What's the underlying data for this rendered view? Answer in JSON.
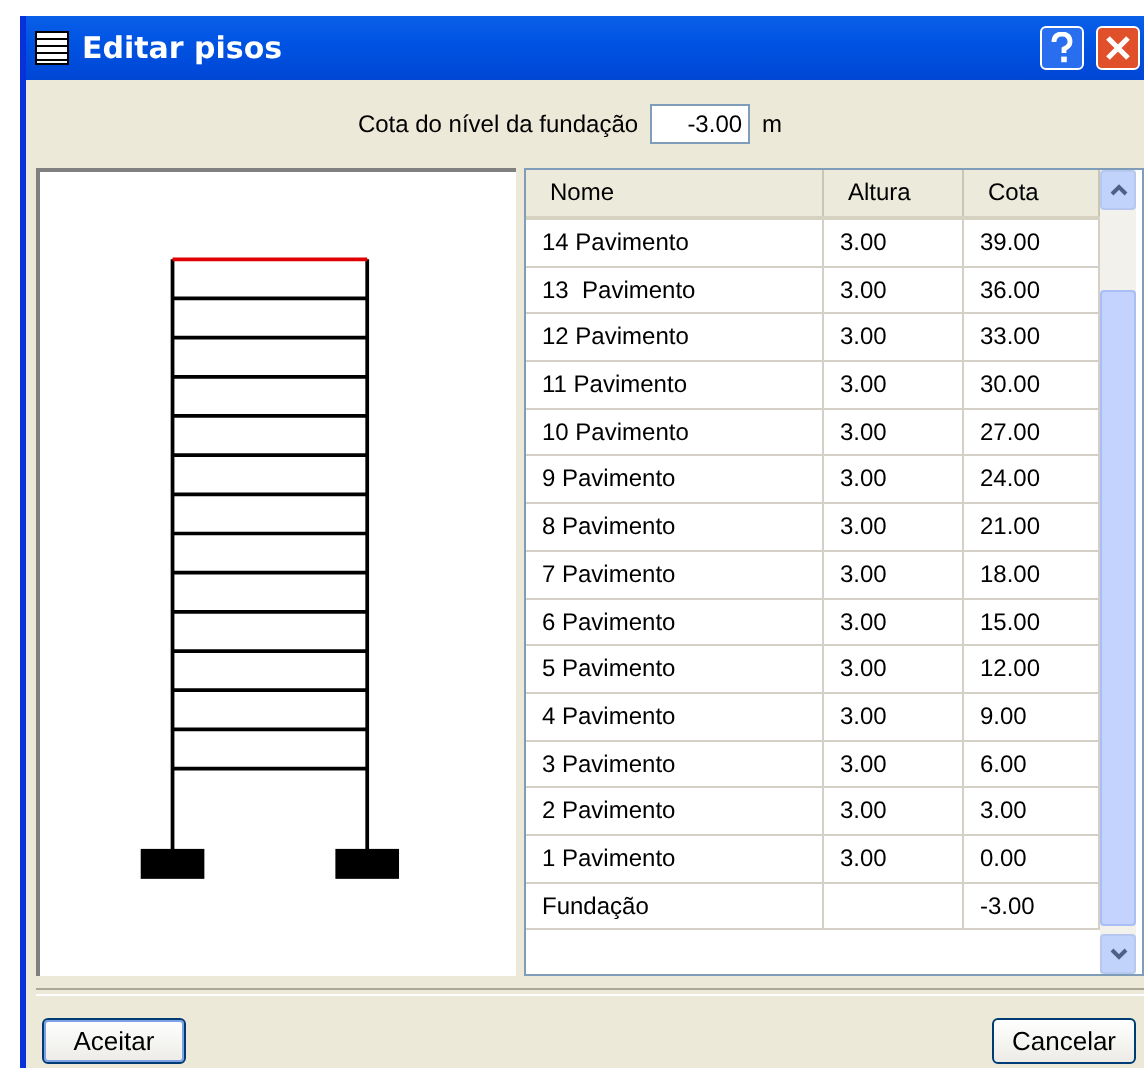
{
  "window": {
    "title": "Editar pisos"
  },
  "foundation_level": {
    "label": "Cota do nível da fundação",
    "value": "-3.00",
    "unit": "m"
  },
  "table": {
    "columns": [
      "Nome",
      "Altura",
      "Cota"
    ],
    "rows": [
      {
        "kind": "floor",
        "name": "14 Pavimento",
        "altura": "3.00",
        "cota": "39.00"
      },
      {
        "kind": "floor",
        "name": "13  Pavimento",
        "altura": "3.00",
        "cota": "36.00"
      },
      {
        "kind": "floor",
        "name": "12 Pavimento",
        "altura": "3.00",
        "cota": "33.00"
      },
      {
        "kind": "floor",
        "name": "11 Pavimento",
        "altura": "3.00",
        "cota": "30.00"
      },
      {
        "kind": "floor",
        "name": "10 Pavimento",
        "altura": "3.00",
        "cota": "27.00"
      },
      {
        "kind": "floor",
        "name": "9 Pavimento",
        "altura": "3.00",
        "cota": "24.00"
      },
      {
        "kind": "floor",
        "name": "8 Pavimento",
        "altura": "3.00",
        "cota": "21.00"
      },
      {
        "kind": "floor",
        "name": "7 Pavimento",
        "altura": "3.00",
        "cota": "18.00"
      },
      {
        "kind": "floor",
        "name": "6 Pavimento",
        "altura": "3.00",
        "cota": "15.00"
      },
      {
        "kind": "floor",
        "name": "5 Pavimento",
        "altura": "3.00",
        "cota": "12.00"
      },
      {
        "kind": "floor",
        "name": "4 Pavimento",
        "altura": "3.00",
        "cota": "9.00"
      },
      {
        "kind": "floor",
        "name": "3 Pavimento",
        "altura": "3.00",
        "cota": "6.00"
      },
      {
        "kind": "floor",
        "name": "2 Pavimento",
        "altura": "3.00",
        "cota": "3.00"
      },
      {
        "kind": "floor",
        "name": "1 Pavimento",
        "altura": "3.00",
        "cota": "0.00"
      },
      {
        "kind": "foundation",
        "name": "Fundação",
        "cota": "-3.00"
      }
    ]
  },
  "buttons": [
    "Aceitar",
    "Cancelar"
  ]
}
